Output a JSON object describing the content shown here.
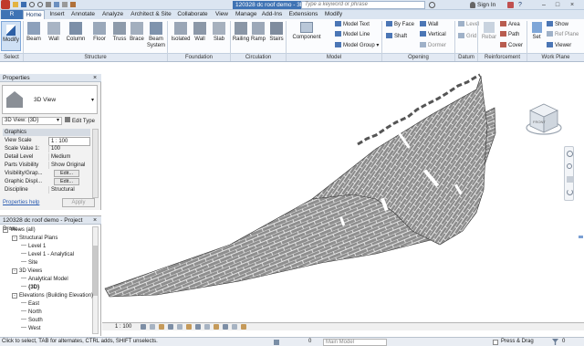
{
  "titlebar": {
    "doc_title": "120328 dc roof demo - 3D View: {3D}",
    "search_placeholder": "Type a keyword or phrase",
    "signin": "Sign In",
    "help": "?"
  },
  "tabs": [
    "Home",
    "Insert",
    "Annotate",
    "Analyze",
    "Architect & Site",
    "Collaborate",
    "View",
    "Manage",
    "Add-Ins",
    "Extensions",
    "Modify"
  ],
  "ribbon": {
    "modify": "Modify",
    "structure_buttons": [
      "Beam",
      "Wall",
      "Column",
      "Floor",
      "Truss",
      "Brace",
      "Beam System"
    ],
    "foundation_buttons": [
      "Isolated",
      "Wall",
      "Slab"
    ],
    "circulation_buttons": [
      "Railing",
      "Ramp",
      "Stairs"
    ],
    "component": "Component",
    "model_items": [
      "Model Text",
      "Model Line",
      "Model Group"
    ],
    "opening_items": [
      "By Face",
      "Shaft",
      "Wall",
      "Vertical",
      "Dormer"
    ],
    "datum_items": [
      "Level",
      "Grid"
    ],
    "reinforcement_items": [
      "Rebar",
      "Area",
      "Path",
      "Cover"
    ],
    "set": "Set",
    "workplane_items": [
      "Show",
      "Ref Plane",
      "Viewer"
    ],
    "panels": [
      "Select",
      "Structure",
      "Foundation",
      "Circulation",
      "Model",
      "Opening",
      "Datum",
      "Reinforcement",
      "Work Plane"
    ]
  },
  "properties": {
    "header": "Properties",
    "type_name": "3D View",
    "selector": "3D View: {3D}",
    "edit_type": "Edit Type",
    "group": "Graphics",
    "rows": [
      {
        "k": "View Scale",
        "v": "1 : 100"
      },
      {
        "k": "Scale Value   1:",
        "v": "100"
      },
      {
        "k": "Detail Level",
        "v": "Medium"
      },
      {
        "k": "Parts Visibility",
        "v": "Show Original"
      },
      {
        "k": "Visibility/Grap...",
        "v": "Edit..."
      },
      {
        "k": "Graphic Displ...",
        "v": "Edit..."
      },
      {
        "k": "Discipline",
        "v": "Structural"
      }
    ],
    "help_link": "Properties help",
    "apply": "Apply"
  },
  "browser": {
    "header": "120328 dc roof demo - Project Brow...",
    "items": [
      {
        "label": "Views (all)",
        "indent": 0,
        "toggle": "-"
      },
      {
        "label": "Structural Plans",
        "indent": 1,
        "toggle": "-"
      },
      {
        "label": "Level 1",
        "indent": 2,
        "toggle": ""
      },
      {
        "label": "Level 1 - Analytical",
        "indent": 2,
        "toggle": ""
      },
      {
        "label": "Site",
        "indent": 2,
        "toggle": ""
      },
      {
        "label": "3D Views",
        "indent": 1,
        "toggle": "-"
      },
      {
        "label": "Analytical Model",
        "indent": 2,
        "toggle": ""
      },
      {
        "label": "{3D}",
        "indent": 2,
        "toggle": ""
      },
      {
        "label": "Elevations (Building Elevation)",
        "indent": 1,
        "toggle": "-"
      },
      {
        "label": "East",
        "indent": 2,
        "toggle": ""
      },
      {
        "label": "North",
        "indent": 2,
        "toggle": ""
      },
      {
        "label": "South",
        "indent": 2,
        "toggle": ""
      },
      {
        "label": "West",
        "indent": 2,
        "toggle": ""
      }
    ]
  },
  "viewcube": {
    "label": "FRONT"
  },
  "viewbar": {
    "scale": "1 : 100"
  },
  "status": {
    "hint": "Click to select, TAB for alternates, CTRL adds, SHIFT unselects.",
    "model": "Main Model",
    "press_drag": "Press & Drag",
    "filter_count": "0"
  },
  "colors": {
    "accent": "#3f73b4",
    "ribbon_bg": "#fbfcfe",
    "tile": "#8c8c8c"
  }
}
